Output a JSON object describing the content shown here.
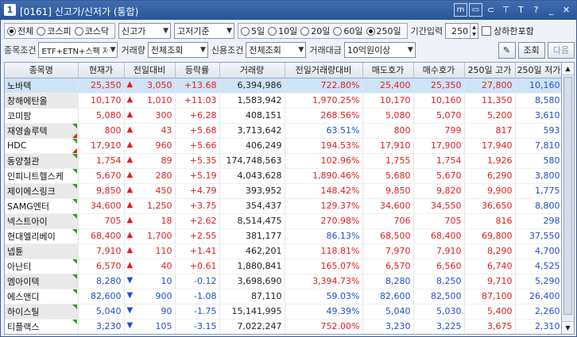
{
  "window": {
    "number": "1",
    "title": "[0161] 신고가/신저가 (통합)"
  },
  "titlebar_icons": [
    "m-box-icon",
    "window-icon",
    "link-icon",
    "pin-icon",
    "text-icon",
    "help-icon",
    "minimize-icon",
    "close-icon"
  ],
  "toolbar1": {
    "market_options": [
      {
        "label": "전체",
        "checked": true
      },
      {
        "label": "코스피",
        "checked": false
      },
      {
        "label": "코스닥",
        "checked": false
      }
    ],
    "type_select": "신고가",
    "basis_select": "고저기준",
    "period_options": [
      {
        "label": "5일",
        "checked": false
      },
      {
        "label": "10일",
        "checked": false
      },
      {
        "label": "20일",
        "checked": false
      },
      {
        "label": "60일",
        "checked": false
      },
      {
        "label": "250일",
        "checked": true
      }
    ],
    "period_input_label": "기간입력",
    "period_input_value": "250",
    "limit_checkbox_label": "상하한포함"
  },
  "toolbar2": {
    "stock_cond_label": "종목조건",
    "stock_cond_value": "ETF+ETN+스팩 저",
    "volume_label": "거래량",
    "volume_value": "전체조회",
    "credit_label": "신용조건",
    "credit_value": "전체조회",
    "amount_label": "거래대금",
    "amount_value": "10억원이상",
    "search_button": "조회",
    "next_button": "다음"
  },
  "table": {
    "columns": [
      "종목명",
      "현재가",
      "전일대비",
      "등락률",
      "거래량",
      "전일거래량대비",
      "매도호가",
      "매수호가",
      "250일 고가",
      "250일 저가"
    ],
    "rows": [
      {
        "name": "노바텍",
        "price": "25,350",
        "dir": "up",
        "change": "3,050",
        "rate": "+13.68",
        "volume": "6,394,986",
        "vol_ratio": "722.80%",
        "ask": "25,400",
        "bid": "25,350",
        "high": "27,800",
        "low": "10,160"
      },
      {
        "name": "창해에탄올",
        "price": "10,170",
        "dir": "up",
        "change": "1,010",
        "rate": "+11.03",
        "volume": "1,583,942",
        "vol_ratio": "1,970.25%",
        "ask": "10,170",
        "bid": "10,160",
        "high": "11,350",
        "low": "8,580"
      },
      {
        "name": "코미팜",
        "price": "5,080",
        "dir": "up",
        "change": "300",
        "rate": "+6.28",
        "volume": "408,151",
        "vol_ratio": "268.56%",
        "ask": "5,080",
        "bid": "5,070",
        "high": "5,200",
        "low": "3,610"
      },
      {
        "name": "재영솔루텍",
        "price": "800",
        "dir": "up",
        "change": "43",
        "rate": "+5.68",
        "volume": "3,713,642",
        "vol_ratio": "63.51%",
        "ask": "800",
        "bid": "799",
        "high": "817",
        "low": "593"
      },
      {
        "name": "HDC",
        "price": "17,910",
        "dir": "up",
        "change": "960",
        "rate": "+5.66",
        "volume": "406,249",
        "vol_ratio": "194.53%",
        "ask": "17,910",
        "bid": "17,900",
        "high": "17,940",
        "low": "7,810"
      },
      {
        "name": "동양철관",
        "price": "1,754",
        "dir": "up",
        "change": "89",
        "rate": "+5.35",
        "volume": "174,748,563",
        "vol_ratio": "102.96%",
        "ask": "1,755",
        "bid": "1,754",
        "high": "1,926",
        "low": "580"
      },
      {
        "name": "인피니트헬스케",
        "price": "5,670",
        "dir": "up",
        "change": "280",
        "rate": "+5.19",
        "volume": "4,043,628",
        "vol_ratio": "1,890.46%",
        "ask": "5,680",
        "bid": "5,670",
        "high": "6,290",
        "low": "3,800"
      },
      {
        "name": "제이에스링크",
        "price": "9,850",
        "dir": "up",
        "change": "450",
        "rate": "+4.79",
        "volume": "393,952",
        "vol_ratio": "148.42%",
        "ask": "9,850",
        "bid": "9,820",
        "high": "9,900",
        "low": "1,775"
      },
      {
        "name": "SAMG엔터",
        "price": "34,600",
        "dir": "up",
        "change": "1,250",
        "rate": "+3.75",
        "volume": "354,437",
        "vol_ratio": "129.37%",
        "ask": "34,600",
        "bid": "34,550",
        "high": "36,650",
        "low": "8,800"
      },
      {
        "name": "넥스트아이",
        "price": "705",
        "dir": "up",
        "change": "18",
        "rate": "+2.62",
        "volume": "8,514,475",
        "vol_ratio": "270.98%",
        "ask": "706",
        "bid": "705",
        "high": "816",
        "low": "298"
      },
      {
        "name": "현대엘리베이",
        "price": "68,400",
        "dir": "up",
        "change": "1,700",
        "rate": "+2.55",
        "volume": "381,177",
        "vol_ratio": "86.13%",
        "ask": "68,500",
        "bid": "68,400",
        "high": "69,800",
        "low": "37,550"
      },
      {
        "name": "넵튠",
        "price": "7,910",
        "dir": "up",
        "change": "110",
        "rate": "+1.41",
        "volume": "462,201",
        "vol_ratio": "118.81%",
        "ask": "7,970",
        "bid": "7,910",
        "high": "8,290",
        "low": "4,700"
      },
      {
        "name": "아난티",
        "price": "6,570",
        "dir": "up",
        "change": "40",
        "rate": "+0.61",
        "volume": "1,880,841",
        "vol_ratio": "165.07%",
        "ask": "6,570",
        "bid": "6,560",
        "high": "6,740",
        "low": "4,525"
      },
      {
        "name": "엠아이텍",
        "price": "8,280",
        "dir": "dn",
        "change": "10",
        "rate": "-0.12",
        "volume": "3,698,690",
        "vol_ratio": "3,394.73%",
        "ask": "8,280",
        "bid": "8,250",
        "high": "9,710",
        "low": "5,290"
      },
      {
        "name": "에스앤디",
        "price": "82,600",
        "dir": "dn",
        "change": "900",
        "rate": "-1.08",
        "volume": "87,110",
        "vol_ratio": "59.03%",
        "ask": "82,600",
        "bid": "82,500",
        "high": "87,100",
        "low": "26,400"
      },
      {
        "name": "하이스틸",
        "price": "5,040",
        "dir": "dn",
        "change": "90",
        "rate": "-1.75",
        "volume": "15,141,995",
        "vol_ratio": "49.39%",
        "ask": "5,040",
        "bid": "5,030",
        "high": "5,400",
        "low": "2,260"
      },
      {
        "name": "티플랙스",
        "price": "3,230",
        "dir": "dn",
        "change": "105",
        "rate": "-3.15",
        "volume": "7,022,247",
        "vol_ratio": "752.00%",
        "ask": "3,230",
        "bid": "3,225",
        "high": "3,675",
        "low": "2,310"
      }
    ]
  },
  "colors": {
    "up": "#e02020",
    "down": "#1f4fd0",
    "header_bar": "#2b5497",
    "selected_row": "#cfe3f7"
  }
}
